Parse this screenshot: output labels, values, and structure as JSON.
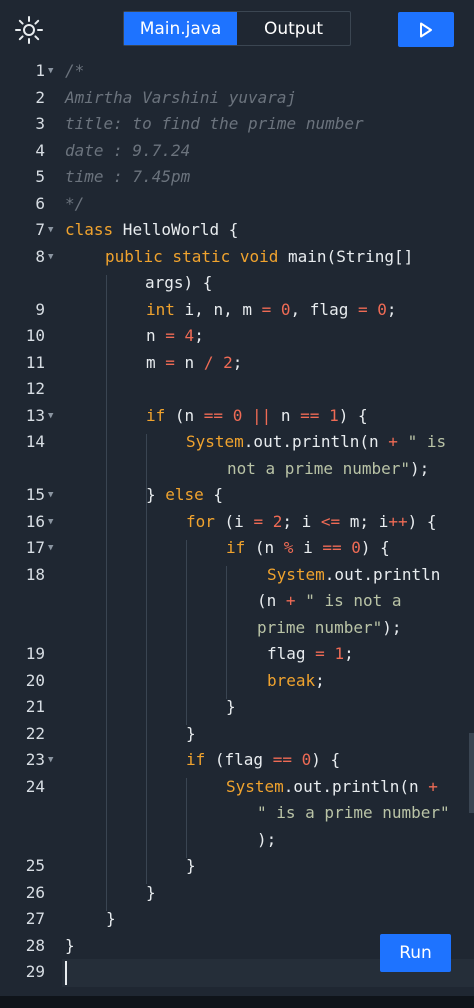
{
  "toolbar": {
    "theme_icon": "sun-icon",
    "tabs": [
      {
        "label": "Main.java",
        "active": true
      },
      {
        "label": "Output",
        "active": false
      }
    ],
    "run_icon": "play-icon"
  },
  "editor": {
    "lines": [
      {
        "n": "1",
        "fold": true
      },
      {
        "n": "2"
      },
      {
        "n": "3"
      },
      {
        "n": "4"
      },
      {
        "n": "5"
      },
      {
        "n": "6"
      },
      {
        "n": "7",
        "fold": true
      },
      {
        "n": "8",
        "fold": true
      },
      {
        "n": "9"
      },
      {
        "n": "10"
      },
      {
        "n": "11"
      },
      {
        "n": "12"
      },
      {
        "n": "13",
        "fold": true
      },
      {
        "n": "14"
      },
      {
        "n": "15",
        "fold": true
      },
      {
        "n": "16",
        "fold": true
      },
      {
        "n": "17",
        "fold": true
      },
      {
        "n": "18"
      },
      {
        "n": "19"
      },
      {
        "n": "20"
      },
      {
        "n": "21"
      },
      {
        "n": "22"
      },
      {
        "n": "23",
        "fold": true
      },
      {
        "n": "24"
      },
      {
        "n": "25"
      },
      {
        "n": "26"
      },
      {
        "n": "27"
      },
      {
        "n": "28"
      },
      {
        "n": "29"
      }
    ],
    "code": {
      "l1": "/*",
      "l2": "Amirtha Varshini yuvaraj",
      "l3": "title: to find the prime number",
      "l4": "date : 9.7.24",
      "l5": "time : 7.45pm",
      "l6": "*/",
      "l7_kw": "class",
      "l7_rest": " HelloWorld {",
      "l8_kw": "public static void",
      "l8_rest": " main(String[]",
      "l8_cont": "args) {",
      "l9_kw": "int",
      "l9_a": " i, n, m ",
      "l9_eq1": "=",
      "l9_b": " ",
      "l9_n1": "0",
      "l9_c": ", flag ",
      "l9_eq2": "=",
      "l9_d": " ",
      "l9_n2": "0",
      "l9_e": ";",
      "l10_a": "n ",
      "l10_eq": "=",
      "l10_b": " ",
      "l10_num": "4",
      "l10_c": ";",
      "l11_a": "m ",
      "l11_eq": "=",
      "l11_b": " n ",
      "l11_op": "/",
      "l11_c": " ",
      "l11_num": "2",
      "l11_d": ";",
      "l13_kw": "if",
      "l13_a": " (n ",
      "l13_op1": "==",
      "l13_b": " ",
      "l13_n1": "0",
      "l13_c": " ",
      "l13_op2": "||",
      "l13_d": " n ",
      "l13_op3": "==",
      "l13_e": " ",
      "l13_n2": "1",
      "l13_f": ") {",
      "l14_a": "System",
      "l14_b": ".out.println(n ",
      "l14_op": "+",
      "l14_c": " ",
      "l14_str": "\" is",
      "l14_cont_str": "not a prime number\"",
      "l14_cont_end": ");",
      "l15": "} ",
      "l15_kw": "else",
      "l15_b": " {",
      "l16_kw": "for",
      "l16_a": " (i ",
      "l16_op1": "=",
      "l16_b": " ",
      "l16_n1": "2",
      "l16_c": "; i ",
      "l16_op2": "<=",
      "l16_d": " m; i",
      "l16_op3": "++",
      "l16_e": ") {",
      "l17_kw": "if",
      "l17_a": " (n ",
      "l17_op1": "%",
      "l17_b": " i ",
      "l17_op2": "==",
      "l17_c": " ",
      "l17_n": "0",
      "l17_d": ") {",
      "l18_a": "System",
      "l18_b": ".out.println",
      "l18_c1_a": "(n ",
      "l18_c1_op": "+",
      "l18_c1_b": " ",
      "l18_c1_str": "\" is not a",
      "l18_c2_str": "prime number\"",
      "l18_c2_end": ");",
      "l19_a": "flag ",
      "l19_eq": "=",
      "l19_b": " ",
      "l19_n": "1",
      "l19_c": ";",
      "l20_kw": "break",
      "l20_b": ";",
      "l21": "}",
      "l22": "}",
      "l23_kw": "if",
      "l23_a": " (flag ",
      "l23_op": "==",
      "l23_b": " ",
      "l23_n": "0",
      "l23_c": ") {",
      "l24_a": "System",
      "l24_b": ".out.println(n ",
      "l24_op": "+",
      "l24_c1_str": "\" is a prime number\"",
      "l24_c2": ");",
      "l25": "}",
      "l26": "}",
      "l27": "}",
      "l28": "}"
    }
  },
  "run_button": {
    "label": "Run"
  }
}
